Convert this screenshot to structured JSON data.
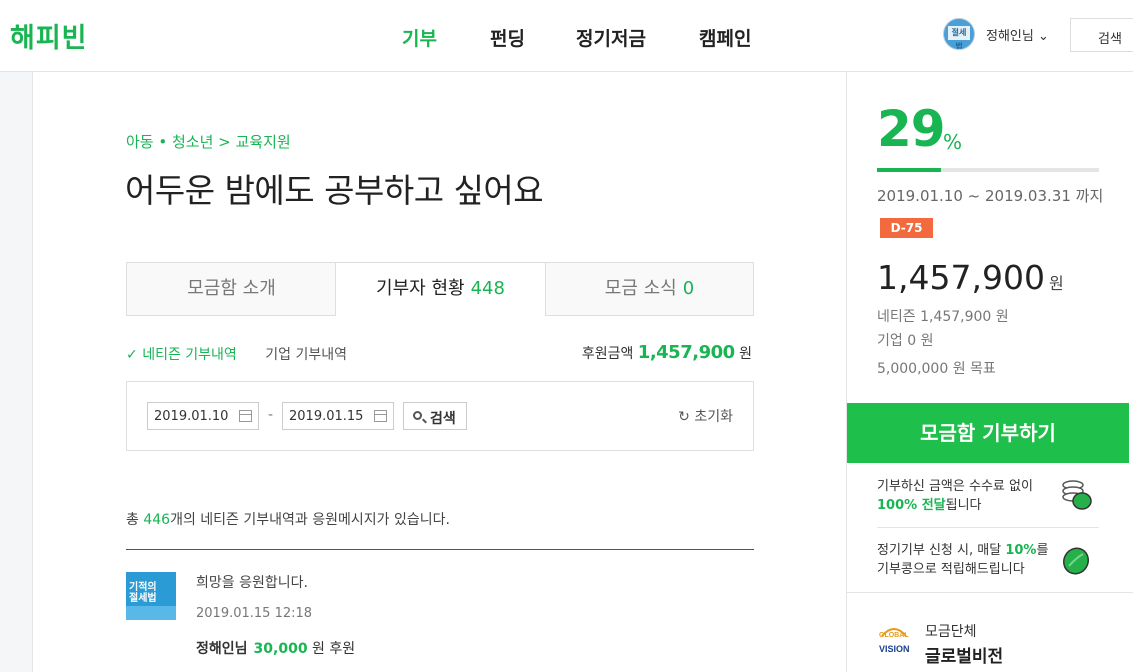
{
  "header": {
    "logo": "해피빈",
    "nav": [
      "기부",
      "펀딩",
      "정기저금",
      "캠페인"
    ],
    "user": "정해인님",
    "search": "검색"
  },
  "campaign": {
    "breadcrumb": "아동 • 청소년 > 교육지원",
    "title": "어두운 밤에도 공부하고 싶어요"
  },
  "tabs": [
    {
      "label": "모금함 소개",
      "count": ""
    },
    {
      "label": "기부자 현황",
      "count": "448"
    },
    {
      "label": "모금 소식",
      "count": "0"
    }
  ],
  "subtabs": {
    "netizen": "네티즌 기부내역",
    "company": "기업 기부내역"
  },
  "total": {
    "label": "후원금액",
    "value": "1,457,900",
    "unit": "원"
  },
  "filter": {
    "from": "2019.01.10",
    "to": "2019.01.15",
    "search": "검색",
    "reset": "초기화"
  },
  "summary": {
    "prefix": "총 ",
    "count": "446",
    "suffix": "개의 네티즌 기부내역과 응원메시지가 있습니다."
  },
  "entry": {
    "book_title": "기적의\n절세법",
    "message": "희망을 응원합니다.",
    "date": "2019.01.15 12:18",
    "name": "정해인님",
    "amount": "30,000",
    "suffix": "원 후원"
  },
  "side": {
    "percent": "29",
    "percent_sign": "%",
    "progress": 0.29,
    "period": "2019.01.10 ~ 2019.03.31 까지",
    "dday": "D-75",
    "amount": "1,457,900",
    "won": "원",
    "netizen": "네티즌 1,457,900 원",
    "company": "기업 0 원",
    "goal": "5,000,000 원 목표",
    "cta": "모금함 기부하기",
    "info1_a": "기부하신 금액은 수수료 없이",
    "info1_b": "100% 전달",
    "info1_c": "됩니다",
    "info2_a": "정기기부 신청 시, 매달 ",
    "info2_b": "10%",
    "info2_c": "를",
    "info2_d": "기부콩으로 적립해드립니다",
    "org_label": "모금단체",
    "org_name": "글로벌비전",
    "org_logo": "GLOBAL VISION"
  },
  "colors": {
    "accent": "#19b553",
    "cta": "#1fbf4b",
    "dday": "#f26a3d"
  }
}
